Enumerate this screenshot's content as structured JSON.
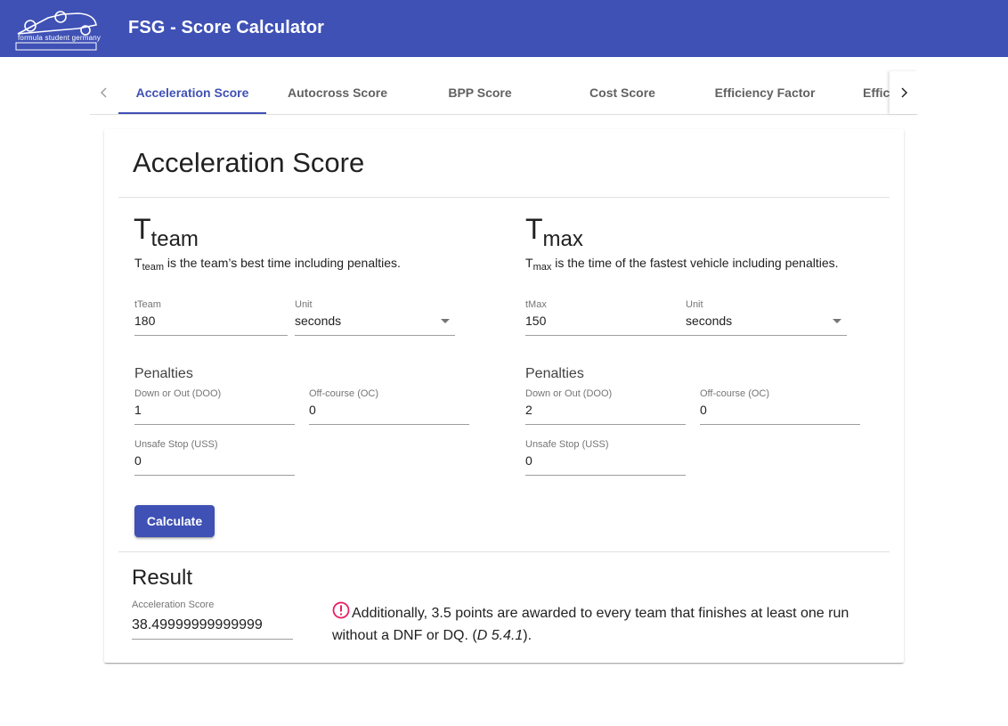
{
  "app": {
    "logo_text": "formula student germany",
    "title": "FSG - Score Calculator"
  },
  "tabs": [
    {
      "label": "Acceleration Score",
      "active": true
    },
    {
      "label": "Autocross Score"
    },
    {
      "label": "BPP Score"
    },
    {
      "label": "Cost Score"
    },
    {
      "label": "Efficiency Factor"
    },
    {
      "label": "Effici"
    }
  ],
  "card": {
    "title": "Acceleration Score",
    "team": {
      "symbol_main": "T",
      "symbol_sub": "team",
      "desc_sub": "team",
      "desc_text": " is the team’s best time including penalties.",
      "input_label": "tTeam",
      "input_value": "180",
      "unit_label": "Unit",
      "unit_value": "seconds",
      "penalties_title": "Penalties",
      "doo_label": "Down or Out (DOO)",
      "doo_value": "1",
      "oc_label": "Off-course (OC)",
      "oc_value": "0",
      "uss_label": "Unsafe Stop (USS)",
      "uss_value": "0"
    },
    "max": {
      "symbol_main": "T",
      "symbol_sub": "max",
      "desc_sub": "max",
      "desc_text": " is the time of the fastest vehicle including penalties.",
      "input_label": "tMax",
      "input_value": "150",
      "unit_label": "Unit",
      "unit_value": "seconds",
      "penalties_title": "Penalties",
      "doo_label": "Down or Out (DOO)",
      "doo_value": "2",
      "oc_label": "Off-course (OC)",
      "oc_value": "0",
      "uss_label": "Unsafe Stop (USS)",
      "uss_value": "0"
    },
    "calculate_label": "Calculate",
    "result": {
      "title": "Result",
      "score_label": "Acceleration Score",
      "score_value": "38.49999999999999",
      "note_text": "Additionally, 3.5 points are awarded to every team that finishes at least one run without a DNF or DQ. (",
      "note_ref": "D 5.4.1",
      "note_end": ")."
    }
  },
  "colors": {
    "primary": "#3f51b5",
    "warn": "#e91e63"
  }
}
